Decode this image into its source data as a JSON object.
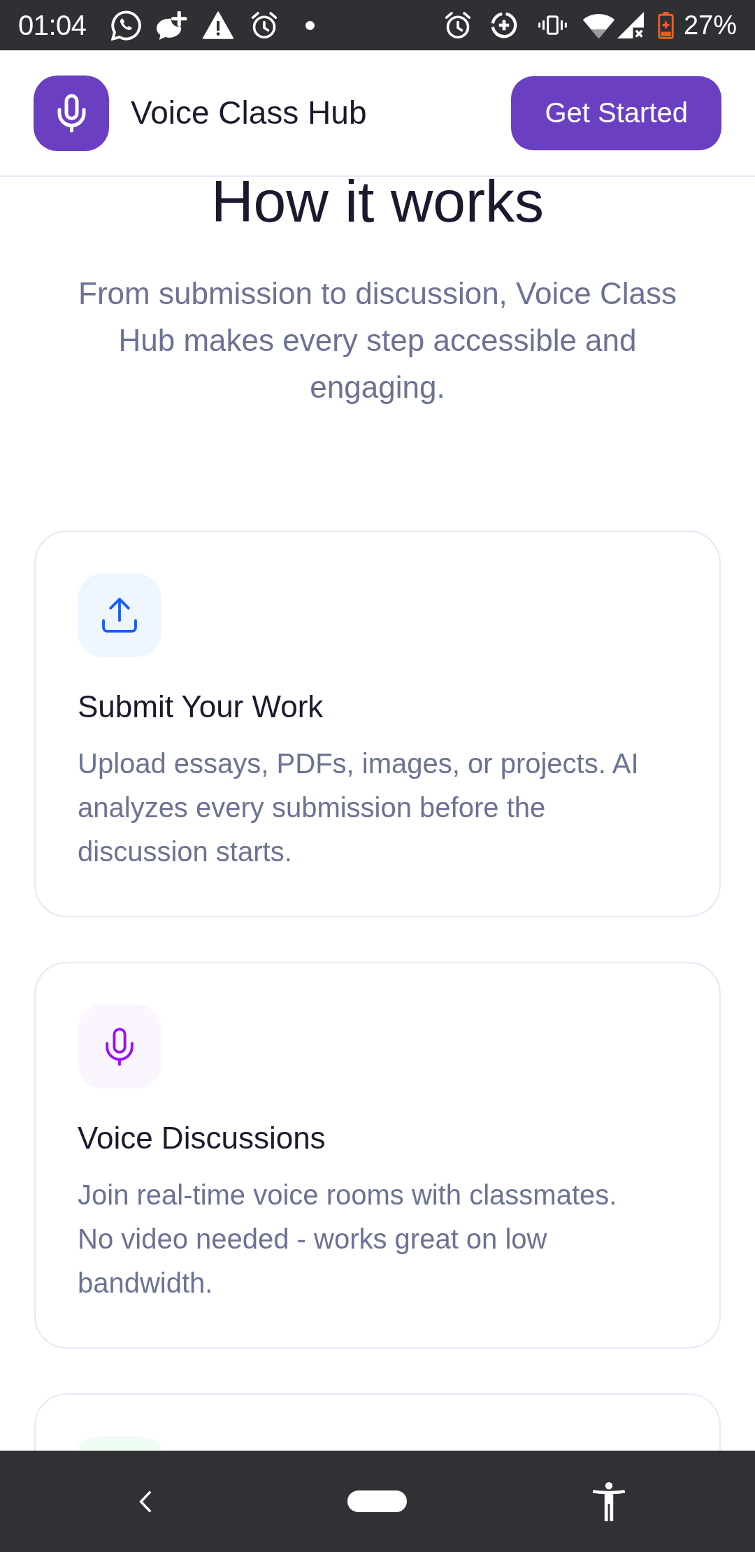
{
  "status_bar": {
    "time": "01:04",
    "battery": "27%"
  },
  "header": {
    "app_name": "Voice Class Hub",
    "cta": "Get Started"
  },
  "section": {
    "title": "How it works",
    "subtitle": "From submission to discussion, Voice Class Hub makes every step accessible and engaging.",
    "features": [
      {
        "icon": {
          "kind": "upload",
          "color": "#155dfc"
        },
        "color": "#eff6ff",
        "title": "Submit Your Work",
        "description": "Upload essays, PDFs, images, or projects. AI analyzes every submission before the discussion starts."
      },
      {
        "icon": {
          "kind": "mic",
          "color": "#9810fa"
        },
        "color": "#faf5ff",
        "title": "Voice Discussions",
        "description": "Join real-time voice rooms with classmates. No video needed - works great on low bandwidth."
      },
      {
        "color": "#f0fdf4"
      }
    ]
  }
}
